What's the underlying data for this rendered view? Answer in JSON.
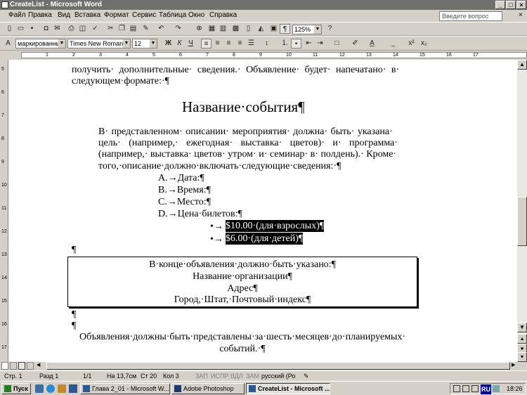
{
  "window": {
    "title": "CreateList - Microsoft Word"
  },
  "menu": {
    "items": [
      "Файл",
      "Правка",
      "Вид",
      "Вставка",
      "Формат",
      "Сервис",
      "Таблица",
      "Окно",
      "Справка"
    ],
    "ask_placeholder": "Введите вопрос"
  },
  "toolbar": {
    "zoom": "125%"
  },
  "format_bar": {
    "style": "маркированный",
    "font": "Times New Roman",
    "size": "12"
  },
  "document": {
    "intro_1": "получить· дополнительные· сведения.· Объявление· будет· напечатано· в·",
    "intro_2": "следующем·формате:·¶",
    "heading": "Название·события¶",
    "para_1": "В· представленном· описании· мероприятия· должна· быть· указана·",
    "para_2": "цель· (например,· ежегодная· выставка· цветов)· и· программа·",
    "para_3": "(например,· выставка· цветов· утром· и· семинар· в· полдень).· Кроме·",
    "para_4": "того,·описание·должно·включать·следующие·сведения:·¶",
    "list": [
      "A.→Дата:¶",
      "B.→Время:¶",
      "C.→Место:¶",
      "D.→Цена·билетов:¶"
    ],
    "bullets": [
      "$10.00·(для·взрослых)¶",
      "$6.00·(для·детей)¶"
    ],
    "empty_mark": "¶",
    "box": [
      "В·конце·объявления·должно·быть·указано:¶",
      "Название·организации¶",
      "Адрес¶",
      "Город,·Штат,·Почтовый·индекс¶"
    ],
    "footer_1": "Объявления·должны·быть·представлены·за·шесть·месяцев·до·планируемых·",
    "footer_2": "событий.·¶"
  },
  "status": {
    "page": "Стр. 1",
    "section": "Разд 1",
    "pages": "1/1",
    "at": "На 13,7см",
    "line": "Ст 20",
    "col": "Кол 3",
    "rec": "ЗАП",
    "trk": "ИСПР",
    "ext": "ВДЛ",
    "ovr": "ЗАМ",
    "lang": "русский (Ро"
  },
  "taskbar": {
    "start": "Пуск",
    "tasks": [
      "Глава 2_01 - Microsoft W...",
      "Adobe Photoshop",
      "CreateList - Microsoft ..."
    ],
    "lang": "RU",
    "time": "18:26"
  }
}
